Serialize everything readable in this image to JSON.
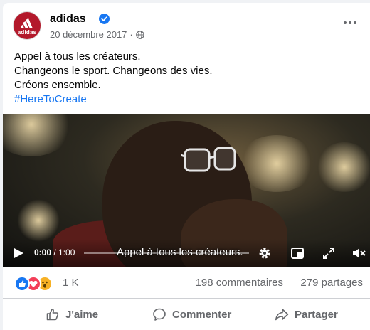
{
  "post": {
    "page_name": "adidas",
    "avatar_text": "adidas",
    "date": "20 décembre 2017",
    "text_lines": [
      "Appel à tous les créateurs.",
      "Changeons le sport. Changeons des vies.",
      "Créons ensemble."
    ],
    "hashtag": "#HereToCreate"
  },
  "video": {
    "current_time": "0:00",
    "duration": "/ 1:00",
    "caption": "Appel à tous les créateurs."
  },
  "stats": {
    "reactions_count": "1 K",
    "comments": "198 commentaires",
    "shares": "279 partages"
  },
  "actions": {
    "like": "J'aime",
    "comment": "Commenter",
    "share": "Partager"
  },
  "icons": {
    "verified": "verified-badge-icon",
    "globe": "globe-icon",
    "more": "more-options-icon",
    "play": "play-icon",
    "settings": "gear-icon",
    "pip": "picture-in-picture-icon",
    "fullscreen": "fullscreen-icon",
    "volume": "volume-muted-icon"
  },
  "colors": {
    "brand_blue": "#1877f2",
    "avatar_red": "#b3192b",
    "secondary_text": "#65676b"
  }
}
